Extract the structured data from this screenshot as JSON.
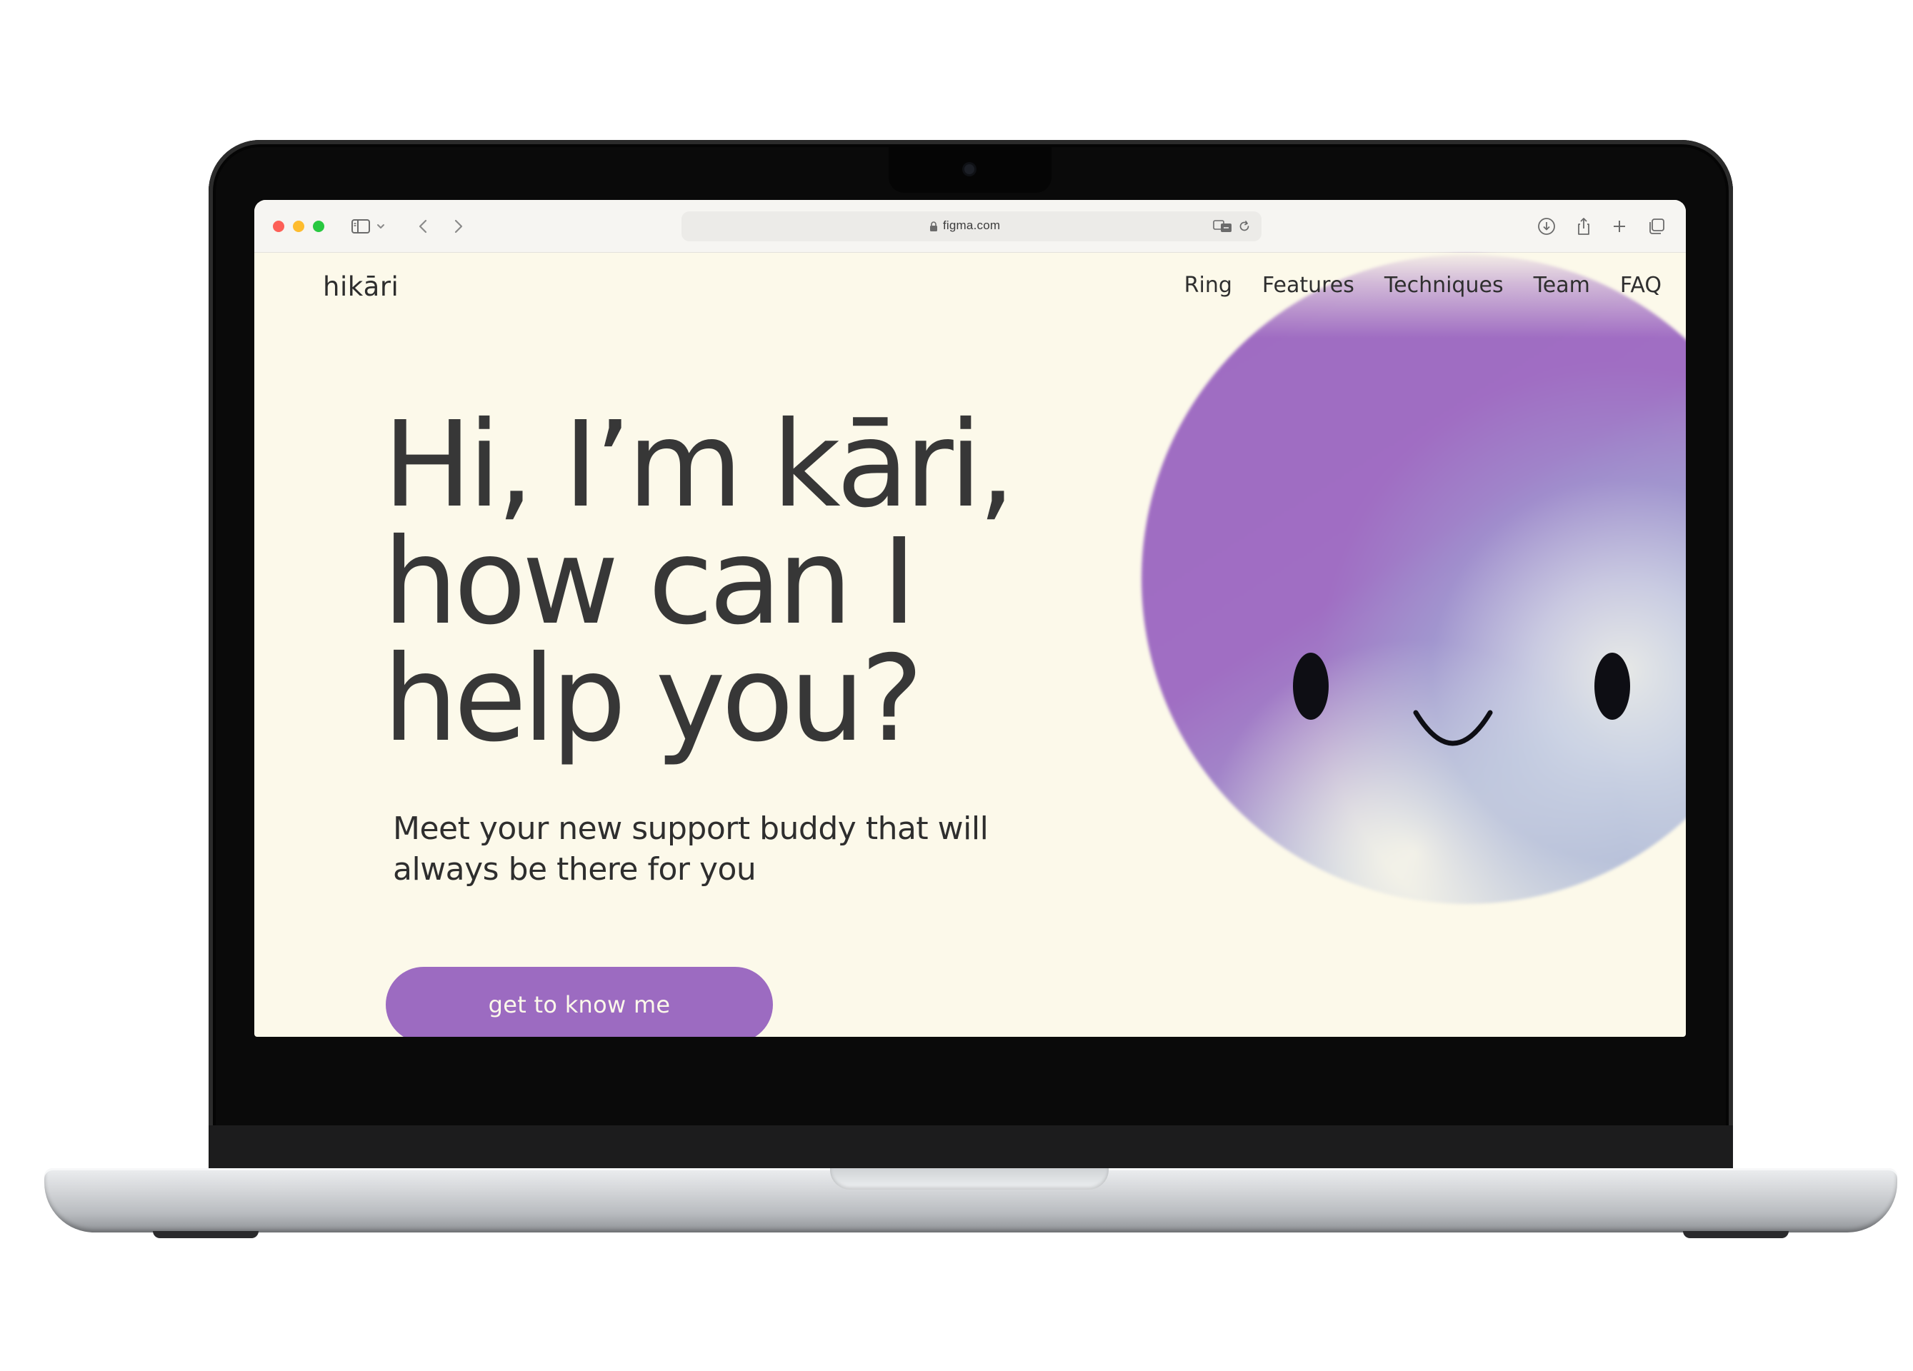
{
  "browser": {
    "url": "figma.com",
    "toolbar_icons": [
      "sidebar-icon",
      "chevron-down-icon",
      "back-icon",
      "forward-icon",
      "download-icon",
      "share-icon",
      "new-tab-icon",
      "tabs-overview-icon"
    ],
    "url_icons": [
      "lock-icon",
      "translate-icon",
      "reload-icon"
    ]
  },
  "site": {
    "logo": "hikāri",
    "nav": [
      "Ring",
      "Features",
      "Techniques",
      "Team",
      "FAQ"
    ]
  },
  "hero": {
    "headline": [
      "Hi, I’m kāri,",
      "how can I",
      "help you?"
    ],
    "subtext": "Meet your new support buddy that will always be there for you",
    "cta": "get to know me"
  },
  "colors": {
    "page_background": "#fcf9ea",
    "accent_purple": "#9c6bc1",
    "text_dark": "#373737",
    "orb_gradient": [
      "#9f6cc2",
      "#a0aed6",
      "#f3f1e6"
    ]
  }
}
